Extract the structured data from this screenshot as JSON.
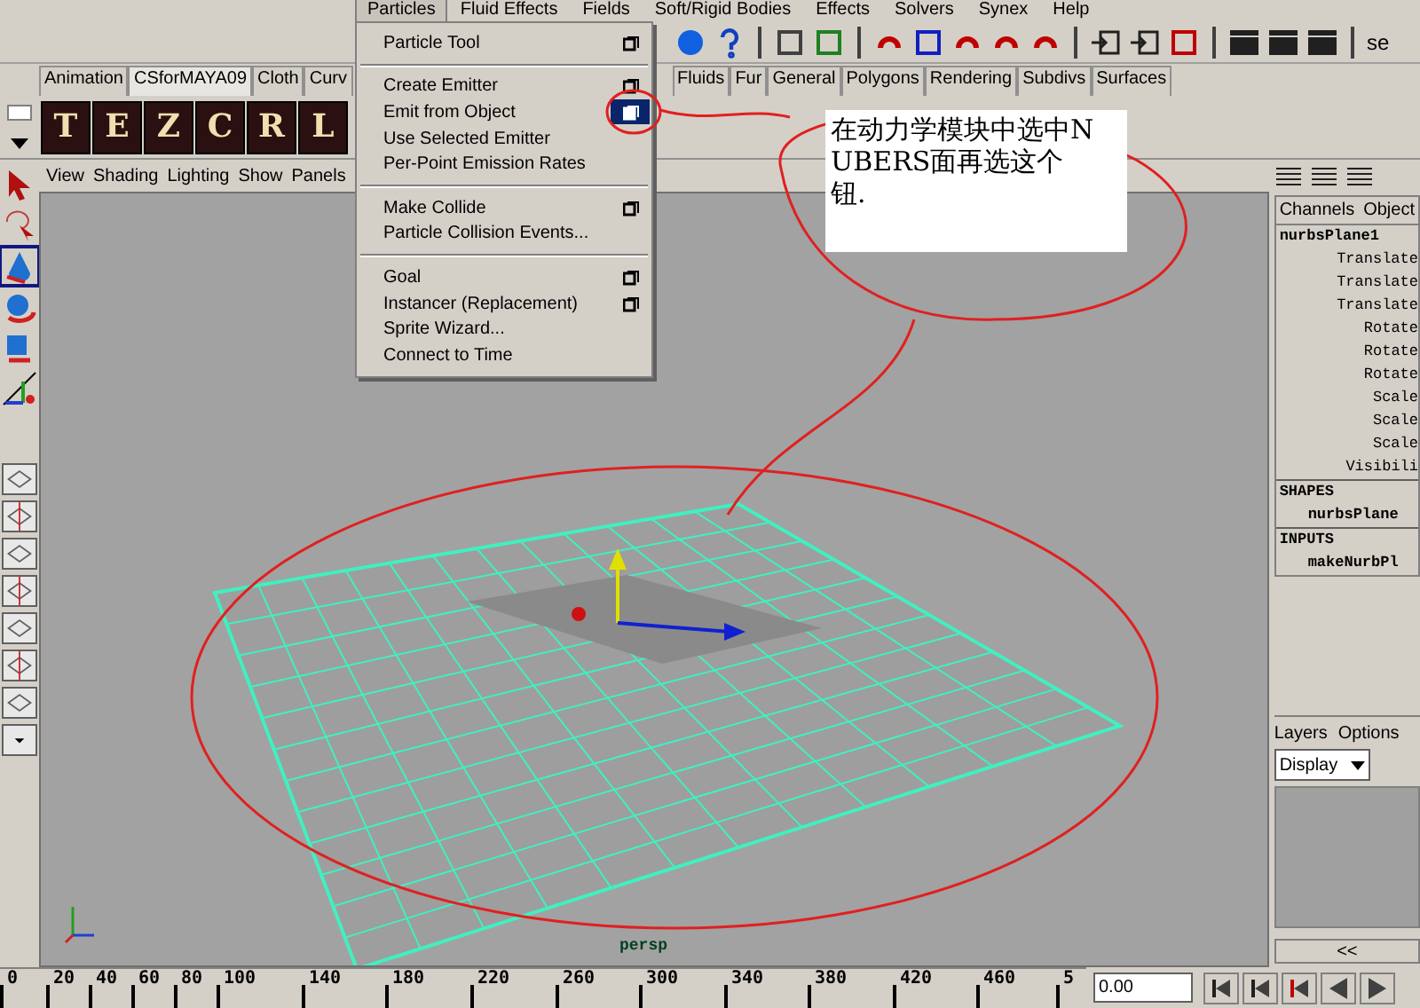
{
  "menu_bar": [
    {
      "label": "Particles",
      "selected": true
    },
    {
      "label": "Fluid Effects",
      "selected": false
    },
    {
      "label": "Fields",
      "selected": false
    },
    {
      "label": "Soft/Rigid Bodies",
      "selected": false
    },
    {
      "label": "Effects",
      "selected": false
    },
    {
      "label": "Solvers",
      "selected": false
    },
    {
      "label": "Synex",
      "selected": false
    },
    {
      "label": "Help",
      "selected": false
    }
  ],
  "toolbar": {
    "field_text": "se"
  },
  "particles_menu": [
    [
      {
        "label": "Particle Tool",
        "option": {
          "selected": false
        }
      }
    ],
    [
      {
        "label": "Create Emitter",
        "option": {
          "selected": false
        }
      },
      {
        "label": "Emit from Object",
        "option": {
          "selected": true
        }
      },
      {
        "label": "Use Selected Emitter"
      },
      {
        "label": "Per-Point Emission Rates"
      }
    ],
    [
      {
        "label": "Make Collide",
        "option": {
          "selected": false
        }
      },
      {
        "label": "Particle Collision Events..."
      }
    ],
    [
      {
        "label": "Goal",
        "option": {
          "selected": false
        }
      },
      {
        "label": "Instancer (Replacement)",
        "option": {
          "selected": false
        }
      },
      {
        "label": "Sprite Wizard..."
      },
      {
        "label": "Connect to Time"
      }
    ]
  ],
  "shelf_tabs_left": [
    {
      "label": "Animation",
      "selected": false
    },
    {
      "label": "CSforMAYA09",
      "selected": true
    },
    {
      "label": "Cloth",
      "selected": false
    },
    {
      "label": "Curv",
      "selected": false
    }
  ],
  "shelf_tabs_right": [
    {
      "label": "Fluids",
      "selected": false
    },
    {
      "label": "Fur",
      "selected": false
    },
    {
      "label": "General",
      "selected": false
    },
    {
      "label": "Polygons",
      "selected": false
    },
    {
      "label": "Rendering",
      "selected": false
    },
    {
      "label": "Subdivs",
      "selected": false
    },
    {
      "label": "Surfaces",
      "selected": false
    }
  ],
  "shelf_buttons": [
    "T",
    "E",
    "Z",
    "C",
    "R",
    "L"
  ],
  "panel_menu": [
    "View",
    "Shading",
    "Lighting",
    "Show",
    "Panels"
  ],
  "viewport": {
    "camera_label": "persp"
  },
  "note": {
    "text": "在动力学模块中选中NUBERS面再选这个钮."
  },
  "channel_box": {
    "tabs": [
      "Channels",
      "Object"
    ],
    "node": "nurbsPlane1",
    "attributes": [
      "Translate",
      "Translate",
      "Translate",
      "Rotate",
      "Rotate",
      "Rotate",
      "Scale",
      "Scale",
      "Scale",
      "Visibili"
    ],
    "sections": [
      {
        "title": "SHAPES",
        "item": "nurbsPlane"
      },
      {
        "title": "INPUTS",
        "item": "makeNurbPl"
      }
    ]
  },
  "layers": {
    "menu": [
      "Layers",
      "Options"
    ],
    "display": "Display",
    "collapse": "<<"
  },
  "time_slider": {
    "ticks": [
      "0",
      "20",
      "40",
      "60",
      "80",
      "100",
      "140",
      "180",
      "220",
      "260",
      "300",
      "340",
      "380",
      "420",
      "460",
      "5"
    ],
    "current": "0.00"
  }
}
